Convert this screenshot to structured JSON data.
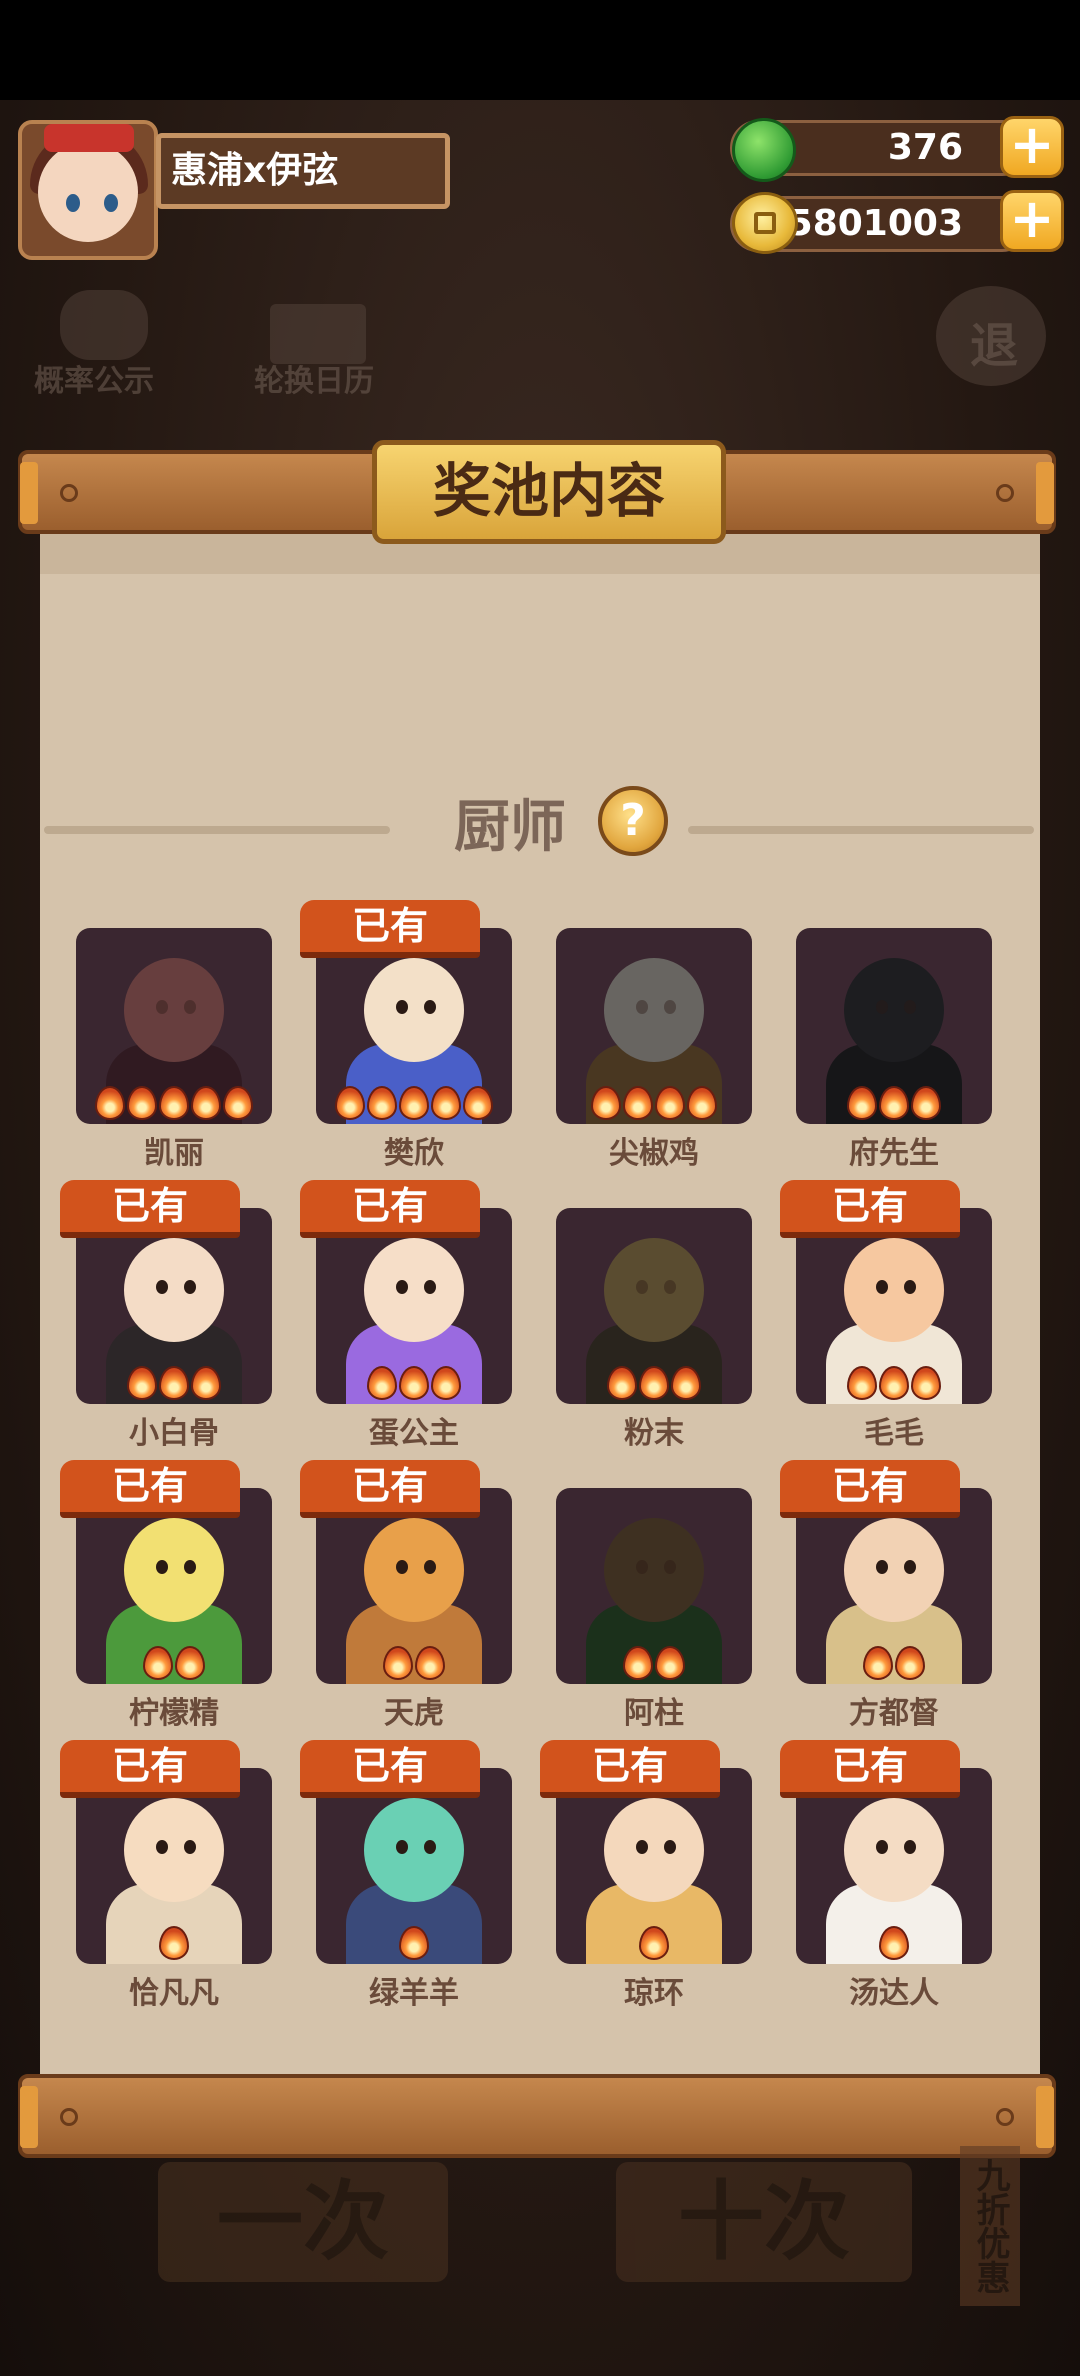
{
  "player": {
    "name": "惠浦x伊弦"
  },
  "currency": {
    "jade": "376",
    "coins": "5801003",
    "plus": "+"
  },
  "background": {
    "probability_label": "概率公示",
    "calendar_label": "轮换日历",
    "exit_label": "退",
    "bottom_buttons": [
      "一次",
      "十次"
    ],
    "side_tag": "九折优惠"
  },
  "panel": {
    "title": "奖池内容",
    "section": "厨师",
    "help": "?"
  },
  "owned_label": "已有",
  "chefs": [
    {
      "name": "凯丽",
      "owned": false,
      "stars": 5,
      "head": "#e58a8a",
      "body": "#6b3a4a"
    },
    {
      "name": "樊欣",
      "owned": true,
      "stars": 5,
      "head": "#f3e0c8",
      "body": "#4a5fc8"
    },
    {
      "name": "尖椒鸡",
      "owned": false,
      "stars": 4,
      "head": "#e8e0d8",
      "body": "#a37a4a"
    },
    {
      "name": "府先生",
      "owned": false,
      "stars": 3,
      "head": "#404048",
      "body": "#303036"
    },
    {
      "name": "小白骨",
      "owned": true,
      "stars": 3,
      "head": "#f4dcc6",
      "body": "#2c2628"
    },
    {
      "name": "蛋公主",
      "owned": true,
      "stars": 3,
      "head": "#f6dec8",
      "body": "#9a6ae0"
    },
    {
      "name": "粉末",
      "owned": false,
      "stars": 3,
      "head": "#c8a96a",
      "body": "#5c5040"
    },
    {
      "name": "毛毛",
      "owned": true,
      "stars": 3,
      "head": "#f6c8a0",
      "body": "#f0e6d6"
    },
    {
      "name": "柠檬精",
      "owned": true,
      "stars": 2,
      "head": "#f2e072",
      "body": "#4c9a3c"
    },
    {
      "name": "天虎",
      "owned": true,
      "stars": 2,
      "head": "#e8a04a",
      "body": "#c07a3a"
    },
    {
      "name": "阿柱",
      "owned": false,
      "stars": 2,
      "head": "#8a6a4a",
      "body": "#3c6a3c"
    },
    {
      "name": "方都督",
      "owned": true,
      "stars": 2,
      "head": "#f2d2b4",
      "body": "#d8c08a"
    },
    {
      "name": "恰凡凡",
      "owned": true,
      "stars": 1,
      "head": "#f6dcc0",
      "body": "#e6d4ba"
    },
    {
      "name": "绿羊羊",
      "owned": true,
      "stars": 1,
      "head": "#6ad0b4",
      "body": "#3a4a7a"
    },
    {
      "name": "琼环",
      "owned": true,
      "stars": 1,
      "head": "#f4d8bc",
      "body": "#e8b866"
    },
    {
      "name": "汤达人",
      "owned": true,
      "stars": 1,
      "head": "#f4dcc4",
      "body": "#f4f0ea"
    }
  ]
}
